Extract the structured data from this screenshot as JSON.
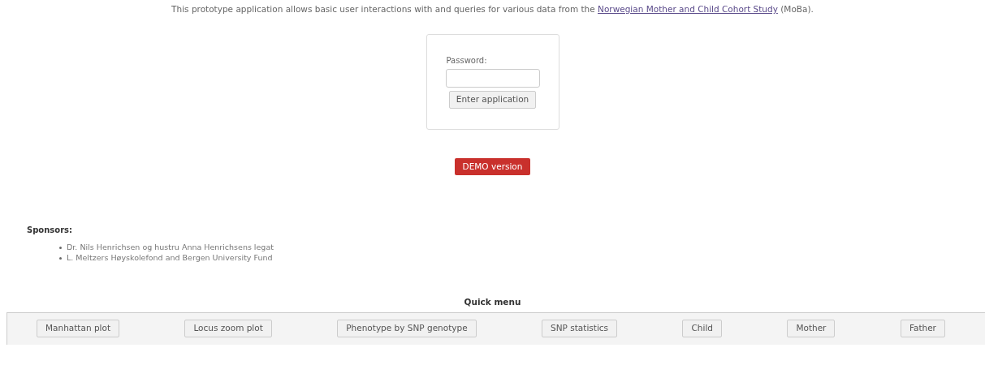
{
  "intro": {
    "before": "This prototype application allows basic user interactions with and queries for various data from the ",
    "link": "Norwegian Mother and Child Cohort Study",
    "after": " (MoBa)."
  },
  "login": {
    "label": "Password:",
    "button": "Enter application"
  },
  "badge": "DEMO version",
  "sponsors": {
    "heading": "Sponsors:",
    "items": [
      "Dr. Nils Henrichsen og hustru Anna Henrichsens legat",
      "L. Meltzers Høyskolefond and Bergen University Fund"
    ]
  },
  "quick_menu": {
    "title": "Quick menu",
    "buttons": [
      "Manhattan plot",
      "Locus zoom plot",
      "Phenotype by SNP genotype",
      "SNP statistics",
      "Child",
      "Mother",
      "Father"
    ]
  }
}
